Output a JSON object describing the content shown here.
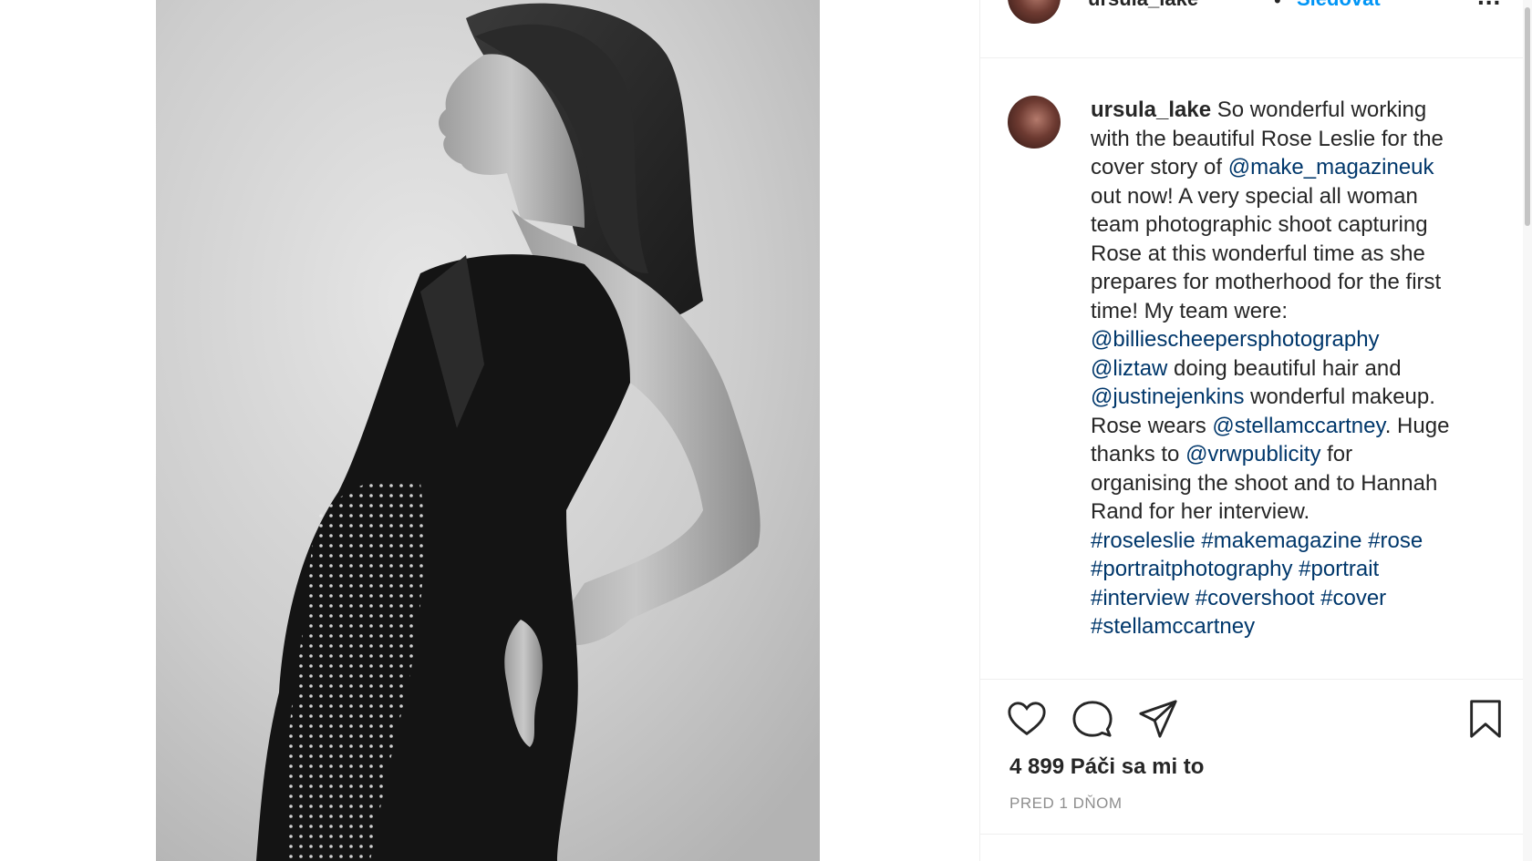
{
  "post": {
    "image_alt": "Black and white portrait of a pregnant woman in a black dress",
    "header": {
      "username": "ursula_lake",
      "separator": "•",
      "follow_label": "Sledovať",
      "more_label": "..."
    },
    "caption": {
      "username": "ursula_lake",
      "line1_text": " So wonderful working",
      "line2": "with the beautiful Rose Leslie for the",
      "line3_text": "cover story of ",
      "mention_make_magazine": "@make_magazineuk",
      "line4": "out now! A very special all woman",
      "line5": "team photographic shoot capturing",
      "line6": "Rose at this wonderful time as she",
      "line7": "prepares for motherhood for the first",
      "line8": "time! My team were:",
      "mention_billie": "@billiescheepersphotography",
      "mention_liztaw": "@liztaw",
      "liztaw_text": " doing beautiful hair and",
      "mention_justine": "@justinejenkins",
      "justine_text": " wonderful makeup.",
      "stella_pre": "Rose wears ",
      "mention_stella": "@stellamccartney",
      "stella_post": ". Huge",
      "thanks_pre": "thanks to ",
      "mention_vrw": "@vrwpublicity",
      "thanks_post": " for",
      "line_organising": "organising the shoot and to Hannah",
      "line_rand": "Rand for her interview.",
      "hashtags": {
        "roseleslie": "#roseleslie",
        "makemagazine": "#makemagazine",
        "rose": "#rose",
        "portraitphotography": "#portraitphotography",
        "portrait": "#portrait",
        "interview": "#interview",
        "covershoot": "#covershoot",
        "cover": "#cover",
        "stellamccartney": "#stellamccartney"
      }
    },
    "actions": {
      "like_icon": "heart-icon",
      "comment_icon": "comment-bubble-icon",
      "share_icon": "paper-plane-icon",
      "save_icon": "bookmark-icon"
    },
    "likes_text": "4 899 Páči sa mi to",
    "timestamp": "PRED 1 DŇOM"
  },
  "colors": {
    "link": "#00376b",
    "follow": "#0095f6",
    "muted": "#8e8e8e",
    "text": "#262626",
    "border": "#efefef"
  }
}
